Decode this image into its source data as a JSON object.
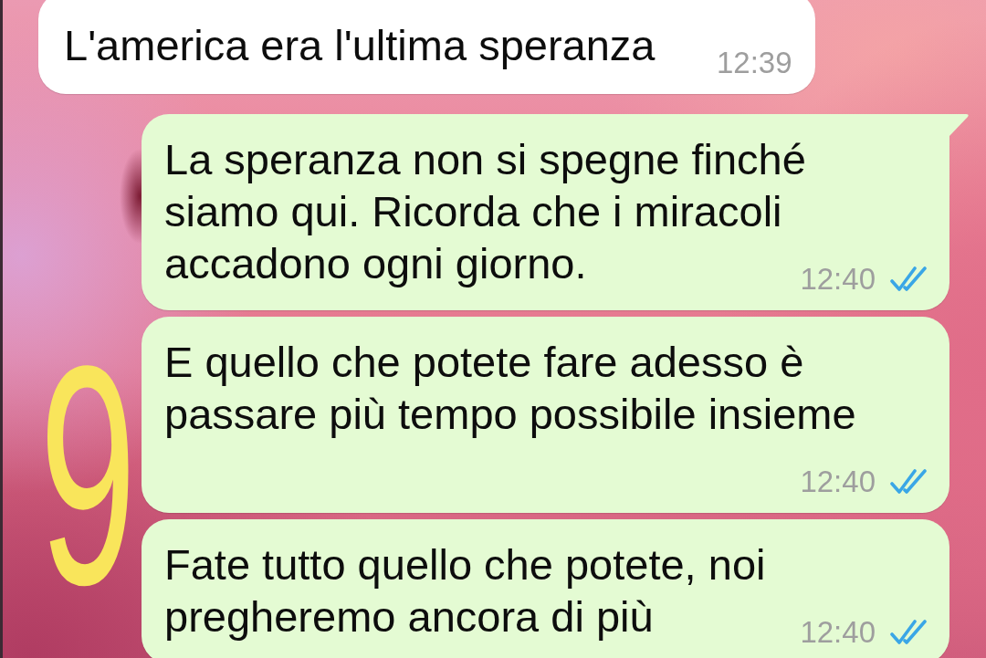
{
  "messages": [
    {
      "kind": "incoming",
      "text": "L'america era l'ultima speranza",
      "time": "12:39"
    },
    {
      "kind": "outgoing",
      "text": "La speranza non si spegne finché siamo qui. Ricorda che i miracoli accadono ogni giorno.",
      "time": "12:40",
      "read": true,
      "tail": true
    },
    {
      "kind": "outgoing",
      "text": "E quello che potete fare adesso è passare più tempo possibile insieme",
      "time": "12:40",
      "read": true,
      "tail": false
    },
    {
      "kind": "outgoing",
      "text": "Fate tutto quello che potete, noi pregheremo ancora di più",
      "time": "12:40",
      "read": true,
      "tail": false
    }
  ],
  "annotation": {
    "text": "9"
  }
}
